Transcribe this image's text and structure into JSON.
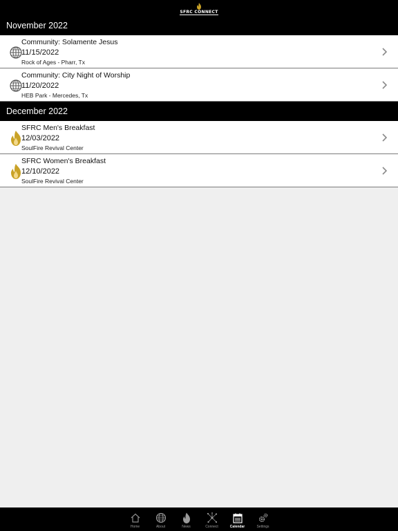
{
  "header": {
    "logo_text": "SFRC CONNECT"
  },
  "sections": [
    {
      "title": "November 2022",
      "events": [
        {
          "title": "Community: Solamente Jesus",
          "date": "11/15/2022",
          "location": "Rock of Ages - Pharr, Tx",
          "icon": "globe-icon"
        },
        {
          "title": "Community: City Night of Worship",
          "date": "11/20/2022",
          "location": "HEB Park - Mercedes, Tx",
          "icon": "globe-icon"
        }
      ]
    },
    {
      "title": "December 2022",
      "events": [
        {
          "title": "SFRC Men's Breakfast",
          "date": "12/03/2022",
          "location": "SoulFire Revival Center",
          "icon": "flame-icon"
        },
        {
          "title": "SFRC Women's Breakfast",
          "date": "12/10/2022",
          "location": "SoulFire Revival Center",
          "icon": "flame-icon"
        }
      ]
    }
  ],
  "tabs": [
    {
      "label": "Home",
      "icon": "home-icon",
      "active": false
    },
    {
      "label": "About",
      "icon": "globe-icon",
      "active": false
    },
    {
      "label": "News",
      "icon": "flame-icon",
      "active": false
    },
    {
      "label": "Connect",
      "icon": "network-icon",
      "active": false
    },
    {
      "label": "Calendar",
      "icon": "calendar-icon",
      "active": true
    },
    {
      "label": "Settings",
      "icon": "gear-icon",
      "active": false
    }
  ],
  "colors": {
    "flame": "#c9a227",
    "header_bg": "#000000",
    "list_bg": "#ffffff",
    "page_bg": "#efefef"
  }
}
